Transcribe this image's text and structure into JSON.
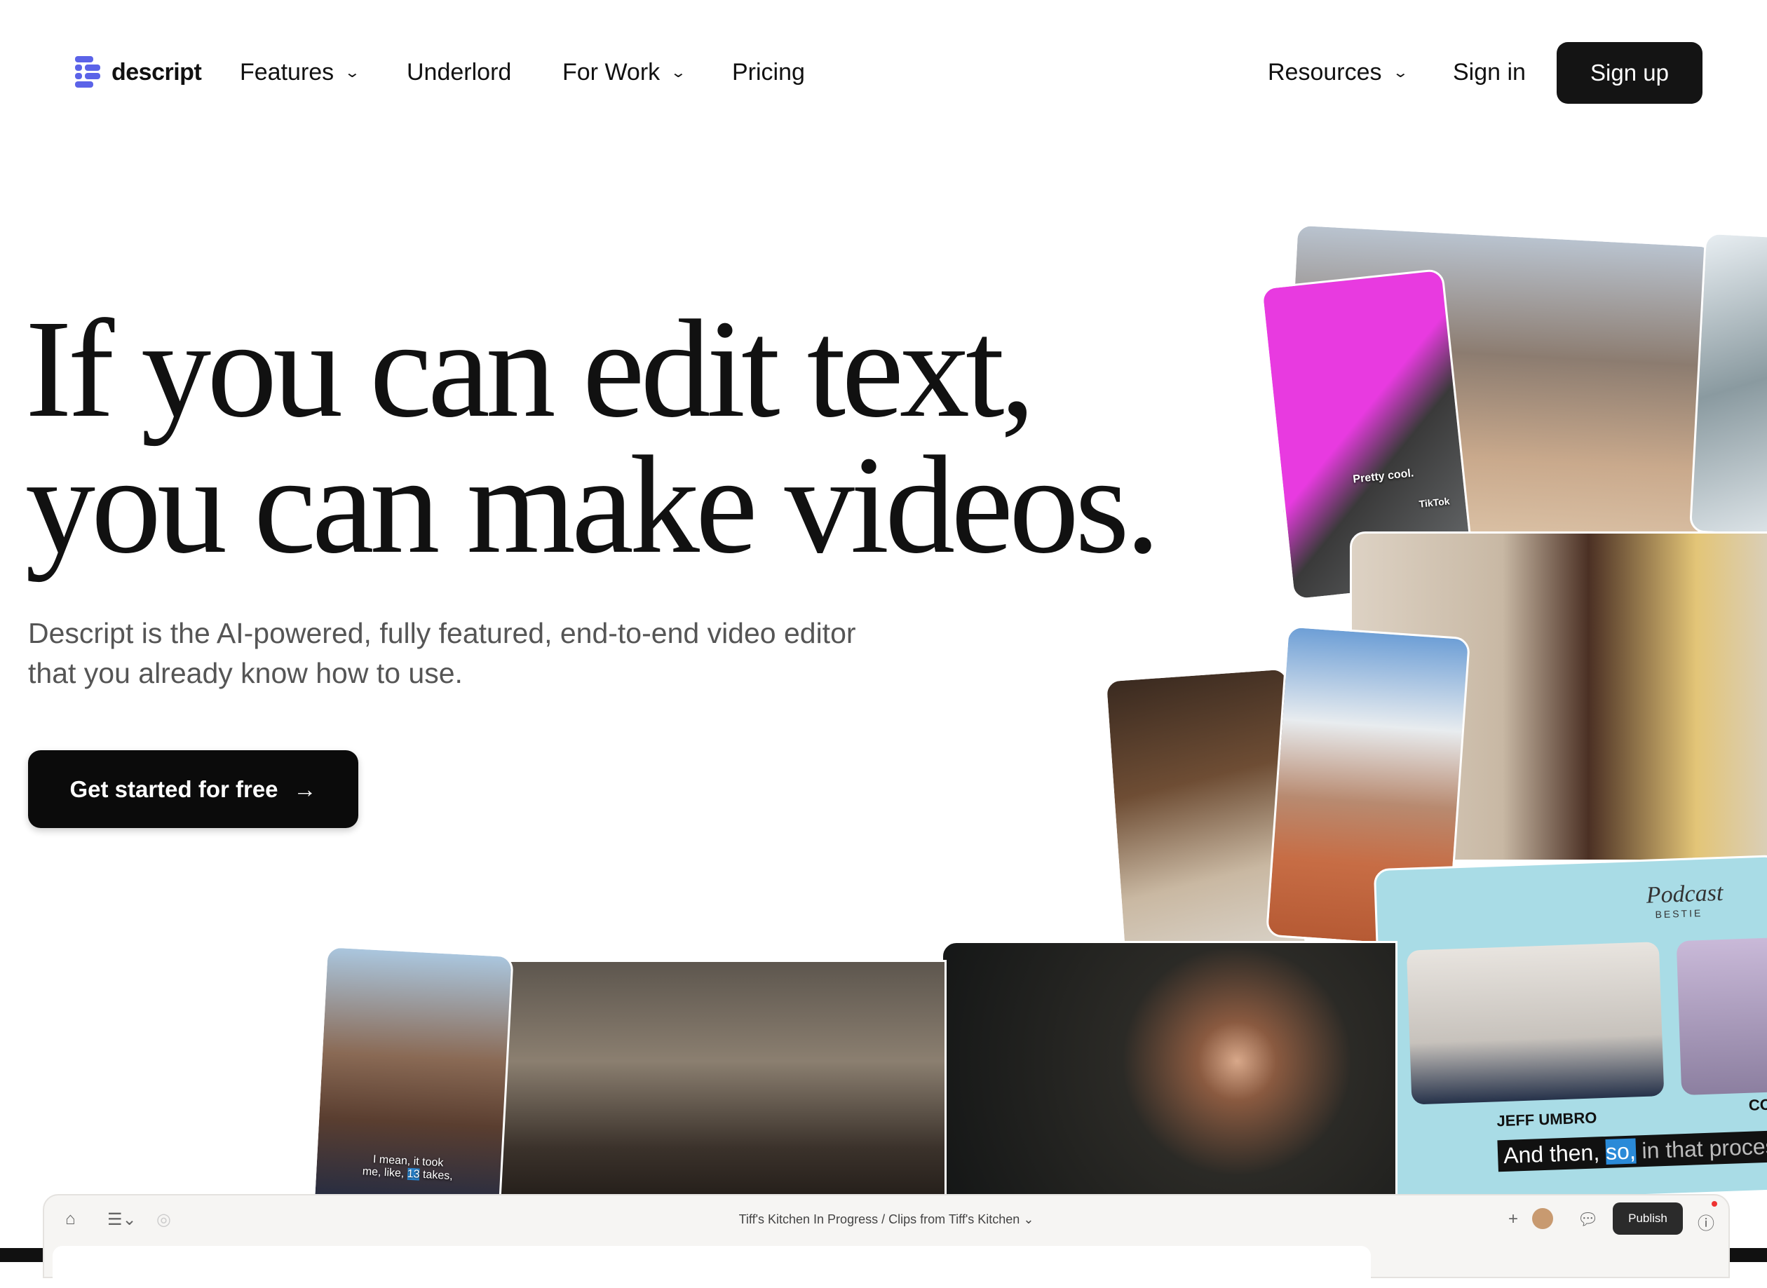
{
  "nav": {
    "brand": "descript",
    "items": [
      {
        "label": "Features",
        "dropdown": true
      },
      {
        "label": "Underlord"
      },
      {
        "label": "For Work",
        "dropdown": true
      },
      {
        "label": "Pricing"
      }
    ],
    "right": [
      {
        "label": "Resources",
        "dropdown": true
      },
      {
        "label": "Sign in"
      }
    ],
    "signup": "Sign up",
    "brand_color": "#5b63e8"
  },
  "hero": {
    "line1": "If you can edit text,",
    "line2": "you can make videos.",
    "subtitle_1": "Descript is the AI-powered, fully featured, end-to-end video editor",
    "subtitle_2": "that you already know how to use.",
    "cta": "Get started for free",
    "cta_icon": "arrow-right-icon"
  },
  "media": {
    "selfie_caption": "Pretty cool.",
    "selfie_badge": "TikTok",
    "takes_1": "I mean, it took",
    "takes_2": "me, like,",
    "takes_num": "13",
    "takes_3": "takes,",
    "podcast_logo": "Podcast",
    "podcast_logo2": "BESTIE",
    "name_tag": "JEFF UMBRO",
    "name_tag2": "CO",
    "subtitle_a": "And then,",
    "subtitle_hl": "so,",
    "subtitle_b": "in that process"
  },
  "app": {
    "crumb_project": "Tiff's Kitchen In Progress",
    "crumb_sep": "/",
    "crumb_comp": "Clips from Tiff's Kitchen",
    "publish": "Publish"
  }
}
